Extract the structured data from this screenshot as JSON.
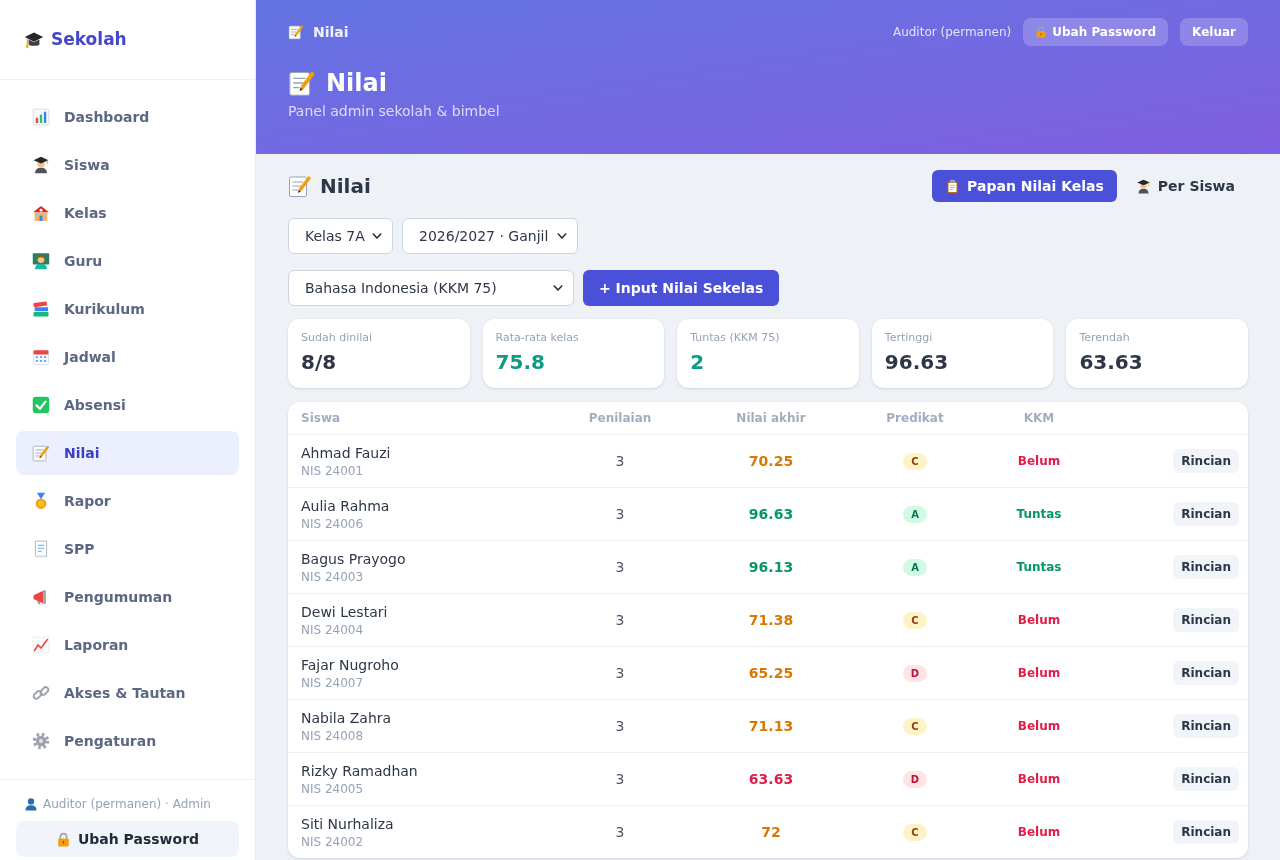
{
  "sidebar": {
    "logo": "Sekolah",
    "items": [
      {
        "label": "Dashboard",
        "selected": false
      },
      {
        "label": "Siswa",
        "selected": false
      },
      {
        "label": "Kelas",
        "selected": false
      },
      {
        "label": "Guru",
        "selected": false
      },
      {
        "label": "Kurikulum",
        "selected": false
      },
      {
        "label": "Jadwal",
        "selected": false
      },
      {
        "label": "Absensi",
        "selected": false
      },
      {
        "label": "Nilai",
        "selected": true
      },
      {
        "label": "Rapor",
        "selected": false
      },
      {
        "label": "SPP",
        "selected": false
      },
      {
        "label": "Pengumuman",
        "selected": false
      },
      {
        "label": "Laporan",
        "selected": false
      },
      {
        "label": "Akses & Tautan",
        "selected": false
      },
      {
        "label": "Pengaturan",
        "selected": false
      }
    ],
    "user_label": "Auditor (permanen) · Admin",
    "password_button": "Ubah Password"
  },
  "header": {
    "breadcrumb": "Nilai",
    "user": "Auditor (permanen)",
    "password_button": "Ubah Password",
    "logout_button": "Keluar",
    "title": "Nilai",
    "subtitle": "Panel admin sekolah & bimbel"
  },
  "content": {
    "title": "Nilai",
    "view_tabs": [
      {
        "label": "Papan Nilai Kelas",
        "selected": true
      },
      {
        "label": "Per Siswa",
        "selected": false
      }
    ],
    "filters": [
      "Kelas 7A",
      "2026/2027 · Ganjil"
    ],
    "subject": "Bahasa Indonesia (KKM 75)",
    "input_button": "+ Input Nilai Sekelas",
    "stats": [
      {
        "label": "Sudah dinilai",
        "value": "8/8",
        "kind": "plain"
      },
      {
        "label": "Rata-rata kelas",
        "value": "75.8",
        "kind": "accent"
      },
      {
        "label": "Tuntas (KKM 75)",
        "value": "2",
        "kind": "accent"
      },
      {
        "label": "Tertinggi",
        "value": "96.63",
        "kind": "plain"
      },
      {
        "label": "Terendah",
        "value": "63.63",
        "kind": "plain"
      }
    ],
    "table": {
      "columns": [
        "Siswa",
        "Penilaian",
        "Nilai akhir",
        "Predikat",
        "KKM"
      ],
      "rows": [
        {
          "name": "Ahmad Fauzi",
          "nis": "NIS 24001",
          "assessments": "3",
          "score": {
            "text": "70.25",
            "kind": "warning"
          },
          "grade": {
            "text": "C",
            "kind": "warning"
          },
          "kkm": {
            "text": "Belum",
            "kind": "danger"
          },
          "action": "Rincian"
        },
        {
          "name": "Aulia Rahma",
          "nis": "NIS 24006",
          "assessments": "3",
          "score": {
            "text": "96.63",
            "kind": "success"
          },
          "grade": {
            "text": "A",
            "kind": "success"
          },
          "kkm": {
            "text": "Tuntas",
            "kind": "success"
          },
          "action": "Rincian"
        },
        {
          "name": "Bagus Prayogo",
          "nis": "NIS 24003",
          "assessments": "3",
          "score": {
            "text": "96.13",
            "kind": "success"
          },
          "grade": {
            "text": "A",
            "kind": "success"
          },
          "kkm": {
            "text": "Tuntas",
            "kind": "success"
          },
          "action": "Rincian"
        },
        {
          "name": "Dewi Lestari",
          "nis": "NIS 24004",
          "assessments": "3",
          "score": {
            "text": "71.38",
            "kind": "warning"
          },
          "grade": {
            "text": "C",
            "kind": "warning"
          },
          "kkm": {
            "text": "Belum",
            "kind": "danger"
          },
          "action": "Rincian"
        },
        {
          "name": "Fajar Nugroho",
          "nis": "NIS 24007",
          "assessments": "3",
          "score": {
            "text": "65.25",
            "kind": "warning"
          },
          "grade": {
            "text": "D",
            "kind": "danger"
          },
          "kkm": {
            "text": "Belum",
            "kind": "danger"
          },
          "action": "Rincian"
        },
        {
          "name": "Nabila Zahra",
          "nis": "NIS 24008",
          "assessments": "3",
          "score": {
            "text": "71.13",
            "kind": "warning"
          },
          "grade": {
            "text": "C",
            "kind": "warning"
          },
          "kkm": {
            "text": "Belum",
            "kind": "danger"
          },
          "action": "Rincian"
        },
        {
          "name": "Rizky Ramadhan",
          "nis": "NIS 24005",
          "assessments": "3",
          "score": {
            "text": "63.63",
            "kind": "danger"
          },
          "grade": {
            "text": "D",
            "kind": "danger"
          },
          "kkm": {
            "text": "Belum",
            "kind": "danger"
          },
          "action": "Rincian"
        },
        {
          "name": "Siti Nurhaliza",
          "nis": "NIS 24002",
          "assessments": "3",
          "score": {
            "text": "72",
            "kind": "warning"
          },
          "grade": {
            "text": "C",
            "kind": "warning"
          },
          "kkm": {
            "text": "Belum",
            "kind": "danger"
          },
          "action": "Rincian"
        }
      ]
    }
  }
}
